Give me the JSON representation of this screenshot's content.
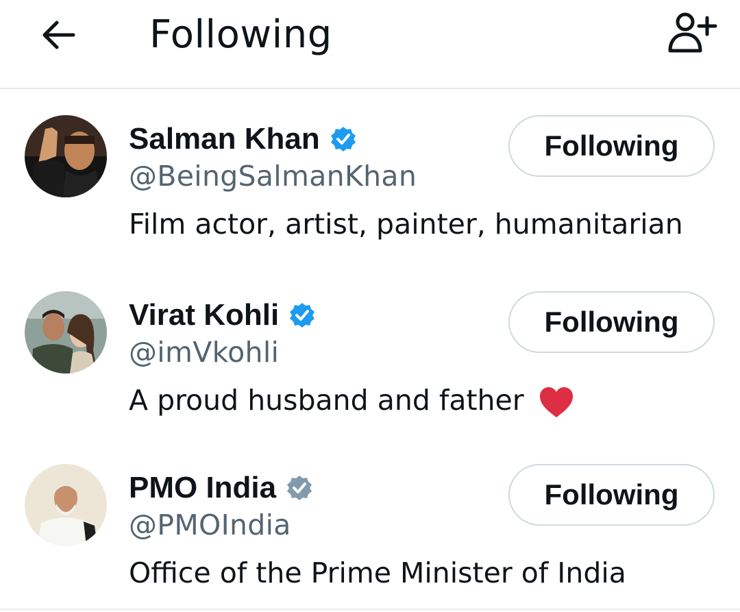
{
  "header": {
    "title": "Following",
    "back_icon": "arrow-left-icon",
    "add_user_icon": "add-user-icon"
  },
  "colors": {
    "verified_blue": "#1d9bf0",
    "verified_gray": "#829aab",
    "handle_gray": "#536471",
    "heart_red": "#dd2e44"
  },
  "users": [
    {
      "name": "Salman Khan",
      "handle": "@BeingSalmanKhan",
      "bio": "Film actor, artist, painter, humanitarian",
      "verified": "blue",
      "button_label": "Following"
    },
    {
      "name": "Virat Kohli",
      "handle": "@imVkohli",
      "bio": "A proud husband and father",
      "bio_emoji": "heart-icon",
      "verified": "blue",
      "button_label": "Following"
    },
    {
      "name": "PMO India",
      "handle": "@PMOIndia",
      "bio": "Office of the Prime Minister of India",
      "verified": "gray",
      "button_label": "Following"
    }
  ]
}
